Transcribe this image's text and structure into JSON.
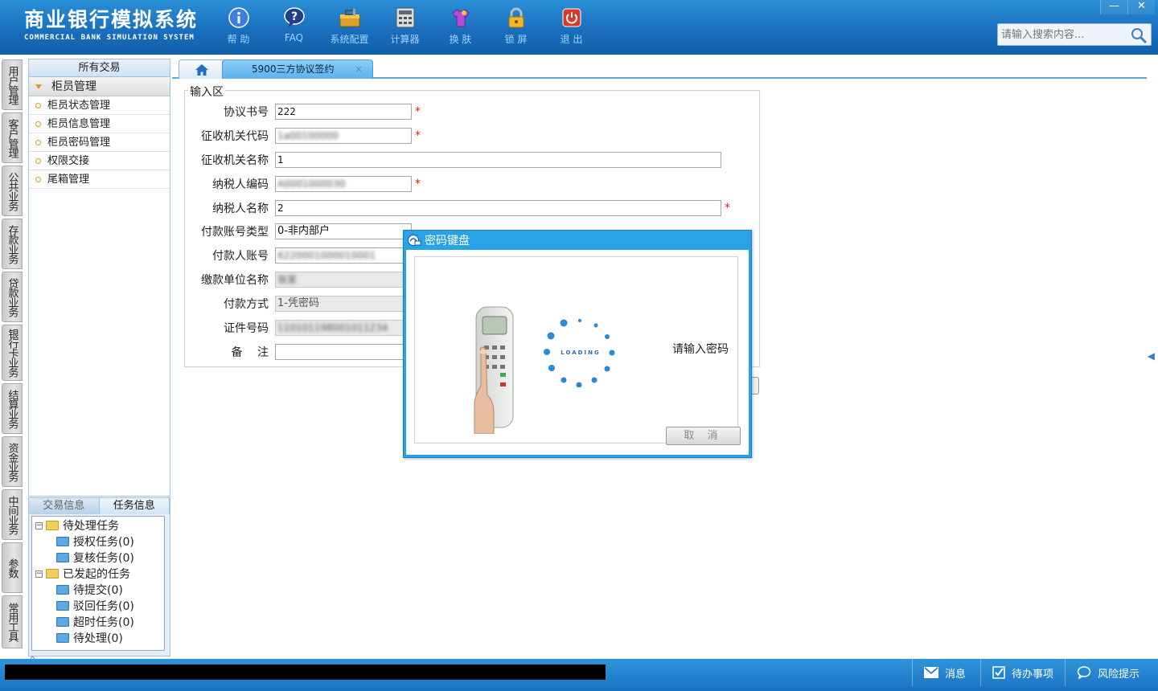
{
  "app": {
    "title_cn": "商业银行模拟系统",
    "title_en": "COMMERCIAL BANK SIMULATION SYSTEM"
  },
  "toolbar": [
    {
      "label": "帮 助",
      "icon": "info-icon"
    },
    {
      "label": "FAQ",
      "icon": "question-icon"
    },
    {
      "label": "系统配置",
      "icon": "toolbox-icon"
    },
    {
      "label": "计算器",
      "icon": "calculator-icon"
    },
    {
      "label": "换 肤",
      "icon": "shirt-icon"
    },
    {
      "label": "锁 屏",
      "icon": "lock-icon"
    },
    {
      "label": "退 出",
      "icon": "power-icon"
    }
  ],
  "window_controls": {
    "minimize": "—",
    "close": "✕"
  },
  "search": {
    "placeholder": "请输入搜索内容..."
  },
  "vnav": [
    "用户管理",
    "客户管理",
    "公共业务",
    "存款业务",
    "贷款业务",
    "银行卡业务",
    "结算业务",
    "资金业务",
    "中间业务",
    "参数",
    "常用工具"
  ],
  "left_panel": {
    "header": "所有交易",
    "group": "柜员管理",
    "items": [
      "柜员状态管理",
      "柜员信息管理",
      "柜员密码管理",
      "权限交接",
      "尾箱管理"
    ]
  },
  "task_panel": {
    "tabs": [
      "交易信息",
      "任务信息"
    ],
    "tree": {
      "pending": "待处理任务",
      "pending_children": [
        "授权任务(0)",
        "复核任务(0)"
      ],
      "initiated": "已发起的任务",
      "initiated_children": [
        "待提交(0)",
        "驳回任务(0)",
        "超时任务(0)",
        "待处理(0)"
      ]
    }
  },
  "tabs": {
    "current": "5900三方协议签约",
    "close": "×"
  },
  "form": {
    "legend": "输入区",
    "fields": [
      {
        "label": "协议书号",
        "value": "222"
      },
      {
        "label": "征收机关代码",
        "value": "1a00100000"
      },
      {
        "label": "征收机关名称",
        "value": "1"
      },
      {
        "label": "纳税人编码",
        "value": "A0001000030"
      },
      {
        "label": "纳税人名称",
        "value": "2"
      },
      {
        "label": "付款账号类型",
        "value": "0-非内部户"
      },
      {
        "label": "付款人账号",
        "value": "6220001000010001"
      },
      {
        "label": "缴款单位名称",
        "value": "张某"
      },
      {
        "label": "付款方式",
        "value": "1-凭密码"
      },
      {
        "label": "证件号码",
        "value": "110101198001011234"
      },
      {
        "label": "备　 注",
        "value": ""
      }
    ],
    "required_mark": "*"
  },
  "dialog": {
    "title": "密码键盘",
    "message": "请输入密码",
    "loading": "LOADING",
    "cancel": "取 消"
  },
  "statusbar": [
    {
      "label": "消息",
      "icon": "mail-icon"
    },
    {
      "label": "待办事项",
      "icon": "checkbox-icon"
    },
    {
      "label": "风险提示",
      "icon": "chat-bubble-icon"
    }
  ],
  "colors": {
    "header": "#1a6fbf",
    "accent": "#28a3e8",
    "required": "#dd2211"
  }
}
